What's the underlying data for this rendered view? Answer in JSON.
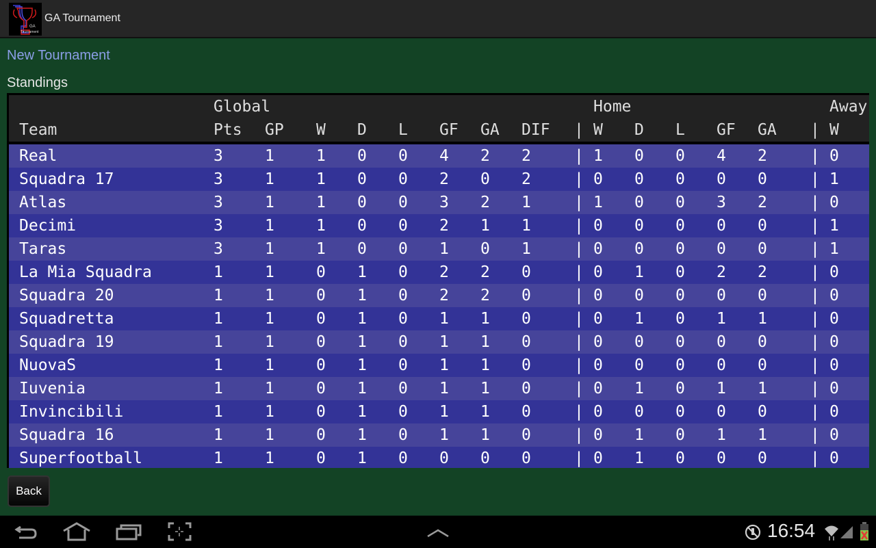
{
  "app": {
    "title": "GA Tournament",
    "icon": "trophy-logo-icon",
    "icon_text": "GA Tournament"
  },
  "links": {
    "new_tournament": "New Tournament"
  },
  "section": {
    "standings_label": "Standings"
  },
  "table": {
    "groups": [
      "Global",
      "Home",
      "Away"
    ],
    "columns": [
      "Team",
      "Pts",
      "GP",
      "W",
      "D",
      "L",
      "GF",
      "GA",
      "DIF",
      "|",
      "W",
      "D",
      "L",
      "GF",
      "GA",
      "|",
      "W"
    ],
    "rows": [
      {
        "team": "Real",
        "pts": "3",
        "gp": "1",
        "w": "1",
        "d": "0",
        "l": "0",
        "gf": "4",
        "ga": "2",
        "dif": "2",
        "hw": "1",
        "hd": "0",
        "hl": "0",
        "hgf": "4",
        "hga": "2",
        "aw": "0"
      },
      {
        "team": "Squadra 17",
        "pts": "3",
        "gp": "1",
        "w": "1",
        "d": "0",
        "l": "0",
        "gf": "2",
        "ga": "0",
        "dif": "2",
        "hw": "0",
        "hd": "0",
        "hl": "0",
        "hgf": "0",
        "hga": "0",
        "aw": "1"
      },
      {
        "team": "Atlas",
        "pts": "3",
        "gp": "1",
        "w": "1",
        "d": "0",
        "l": "0",
        "gf": "3",
        "ga": "2",
        "dif": "1",
        "hw": "1",
        "hd": "0",
        "hl": "0",
        "hgf": "3",
        "hga": "2",
        "aw": "0"
      },
      {
        "team": "Decimi",
        "pts": "3",
        "gp": "1",
        "w": "1",
        "d": "0",
        "l": "0",
        "gf": "2",
        "ga": "1",
        "dif": "1",
        "hw": "0",
        "hd": "0",
        "hl": "0",
        "hgf": "0",
        "hga": "0",
        "aw": "1"
      },
      {
        "team": "Taras",
        "pts": "3",
        "gp": "1",
        "w": "1",
        "d": "0",
        "l": "0",
        "gf": "1",
        "ga": "0",
        "dif": "1",
        "hw": "0",
        "hd": "0",
        "hl": "0",
        "hgf": "0",
        "hga": "0",
        "aw": "1"
      },
      {
        "team": "La Mia Squadra",
        "pts": "1",
        "gp": "1",
        "w": "0",
        "d": "1",
        "l": "0",
        "gf": "2",
        "ga": "2",
        "dif": "0",
        "hw": "0",
        "hd": "1",
        "hl": "0",
        "hgf": "2",
        "hga": "2",
        "aw": "0"
      },
      {
        "team": "Squadra 20",
        "pts": "1",
        "gp": "1",
        "w": "0",
        "d": "1",
        "l": "0",
        "gf": "2",
        "ga": "2",
        "dif": "0",
        "hw": "0",
        "hd": "0",
        "hl": "0",
        "hgf": "0",
        "hga": "0",
        "aw": "0"
      },
      {
        "team": "Squadretta",
        "pts": "1",
        "gp": "1",
        "w": "0",
        "d": "1",
        "l": "0",
        "gf": "1",
        "ga": "1",
        "dif": "0",
        "hw": "0",
        "hd": "1",
        "hl": "0",
        "hgf": "1",
        "hga": "1",
        "aw": "0"
      },
      {
        "team": "Squadra 19",
        "pts": "1",
        "gp": "1",
        "w": "0",
        "d": "1",
        "l": "0",
        "gf": "1",
        "ga": "1",
        "dif": "0",
        "hw": "0",
        "hd": "0",
        "hl": "0",
        "hgf": "0",
        "hga": "0",
        "aw": "0"
      },
      {
        "team": "NuovaS",
        "pts": "1",
        "gp": "1",
        "w": "0",
        "d": "1",
        "l": "0",
        "gf": "1",
        "ga": "1",
        "dif": "0",
        "hw": "0",
        "hd": "0",
        "hl": "0",
        "hgf": "0",
        "hga": "0",
        "aw": "0"
      },
      {
        "team": "Iuvenia",
        "pts": "1",
        "gp": "1",
        "w": "0",
        "d": "1",
        "l": "0",
        "gf": "1",
        "ga": "1",
        "dif": "0",
        "hw": "0",
        "hd": "1",
        "hl": "0",
        "hgf": "1",
        "hga": "1",
        "aw": "0"
      },
      {
        "team": "Invincibili",
        "pts": "1",
        "gp": "1",
        "w": "0",
        "d": "1",
        "l": "0",
        "gf": "1",
        "ga": "1",
        "dif": "0",
        "hw": "0",
        "hd": "0",
        "hl": "0",
        "hgf": "0",
        "hga": "0",
        "aw": "0"
      },
      {
        "team": "Squadra 16",
        "pts": "1",
        "gp": "1",
        "w": "0",
        "d": "1",
        "l": "0",
        "gf": "1",
        "ga": "1",
        "dif": "0",
        "hw": "0",
        "hd": "1",
        "hl": "0",
        "hgf": "1",
        "hga": "1",
        "aw": "0"
      },
      {
        "team": "Superfootball",
        "pts": "1",
        "gp": "1",
        "w": "0",
        "d": "1",
        "l": "0",
        "gf": "0",
        "ga": "0",
        "dif": "0",
        "hw": "0",
        "hd": "1",
        "hl": "0",
        "hgf": "0",
        "hga": "0",
        "aw": "0"
      }
    ]
  },
  "buttons": {
    "back": "Back"
  },
  "navbar": {
    "icons": [
      "back-nav-icon",
      "home-nav-icon",
      "recent-apps-icon",
      "screenshot-icon",
      "chevron-up-icon"
    ],
    "status": {
      "time": "16:54",
      "icons": [
        "no-usb-debug-icon",
        "wifi-icon",
        "signal-icon",
        "battery-alert-icon"
      ]
    }
  },
  "colors": {
    "background": "#134325",
    "row_light": "#46449a",
    "row_dark": "#333397",
    "header_bg": "#222222",
    "link": "#8b9ee6"
  }
}
